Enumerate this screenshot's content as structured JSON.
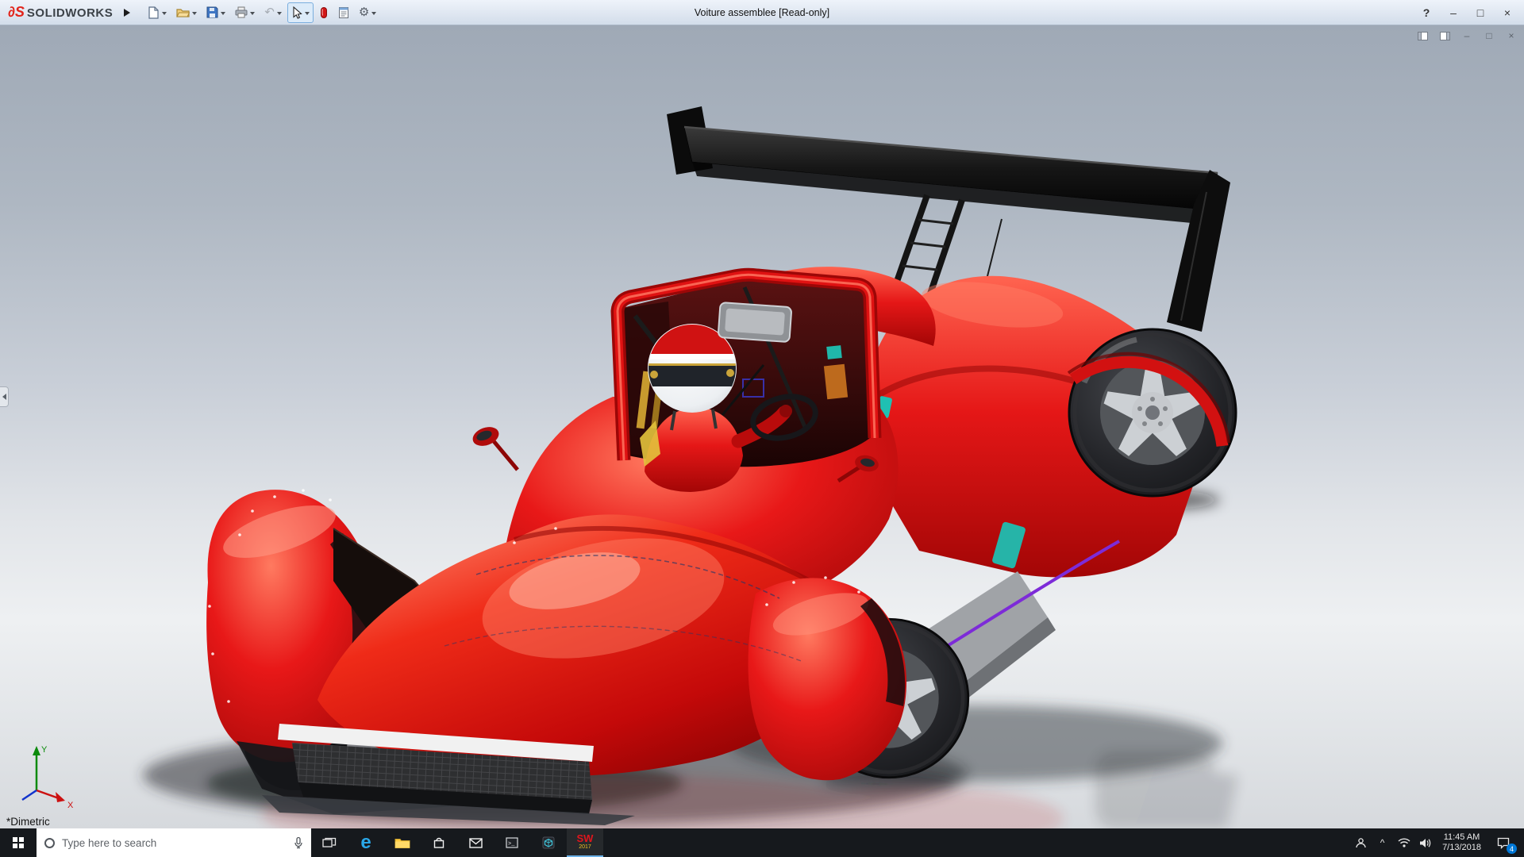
{
  "window": {
    "title": "Voiture assemblee [Read-only]",
    "help_glyph": "?",
    "minimize_glyph": "–",
    "maximize_glyph": "□",
    "close_glyph": "×"
  },
  "brand": {
    "logo_glyph": "∂S",
    "name": "SOLIDWORKS"
  },
  "toolbar": {
    "buttons": [
      "new-document",
      "open",
      "save",
      "print",
      "undo",
      "select",
      "appearance",
      "document-properties",
      "options"
    ],
    "undo_glyph": "↶",
    "gear_glyph": "⚙"
  },
  "doc_controls": {
    "minimize_glyph": "–",
    "restore_glyph": "□",
    "close_glyph": "×"
  },
  "viewport": {
    "view_label": "*Dimetric",
    "axis_x": "X",
    "axis_y": "Y"
  },
  "model": {
    "name": "red-lemans-prototype-race-car",
    "body_color": "#d41216",
    "wing_color": "#121212",
    "accent_purple": "#8a2be2",
    "accent_teal": "#23b7aa"
  },
  "taskbar": {
    "search_placeholder": "Type here to search",
    "edge_glyph": "e",
    "cmd_glyph": ">_",
    "chevron_glyph": "^",
    "solidworks": {
      "label": "SW",
      "year": "2017"
    },
    "clock": {
      "time": "11:45 AM",
      "date": "7/13/2018"
    },
    "notification_count": "4",
    "apps": [
      "start",
      "search",
      "task-view",
      "edge",
      "file-explorer",
      "store",
      "mail",
      "command-prompt",
      "cad-viewer",
      "solidworks-2017"
    ],
    "tray": [
      "people",
      "hidden-icons",
      "network",
      "volume",
      "clock",
      "action-center"
    ]
  }
}
